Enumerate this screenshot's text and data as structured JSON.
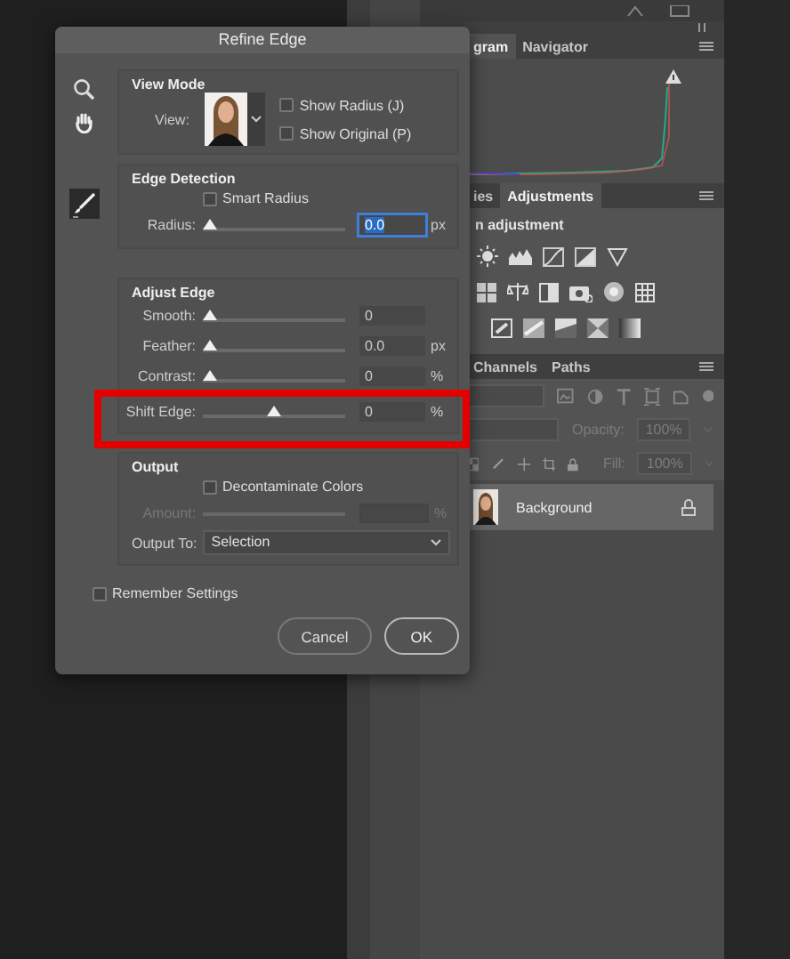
{
  "panels": {
    "top_tabs": [
      {
        "label": "gram",
        "selected": true
      },
      {
        "label": "Navigator",
        "selected": false
      }
    ],
    "adjust_tabs": [
      {
        "label": "ies",
        "selected": false
      },
      {
        "label": "Adjustments",
        "selected": true
      }
    ],
    "adjust_hint": "n adjustment",
    "layer_tabs": [
      {
        "label": "Channels",
        "selected": false
      },
      {
        "label": "Paths",
        "selected": false
      }
    ],
    "opacity": {
      "label": "Opacity:",
      "value": "100%",
      "disabled": true
    },
    "fill": {
      "label": "Fill:",
      "value": "100%",
      "disabled": true
    },
    "layers": [
      {
        "name": "Background",
        "locked": true,
        "selected": true
      }
    ]
  },
  "dialog": {
    "title": "Refine Edge",
    "view_mode": {
      "heading": "View Mode",
      "view_label": "View:",
      "options": [
        {
          "label": "Show Radius (J)",
          "checked": false
        },
        {
          "label": "Show Original (P)",
          "checked": false
        }
      ]
    },
    "edge_detection": {
      "heading": "Edge Detection",
      "smart_radius": {
        "label": "Smart Radius",
        "checked": false
      },
      "radius": {
        "label": "Radius:",
        "level": 0,
        "value": "0.0",
        "unit": "px",
        "focused": true
      }
    },
    "adjust_edge": {
      "heading": "Adjust Edge",
      "sliders": [
        {
          "label": "Smooth:",
          "level": 0,
          "value": "0",
          "highlighted": false
        },
        {
          "label": "Feather:",
          "level": 0,
          "value": "0.0",
          "unit": "px",
          "highlighted": false
        },
        {
          "label": "Contrast:",
          "level": 0,
          "value": "0",
          "unit": "%",
          "highlighted": false
        },
        {
          "label": "Shift Edge:",
          "level": 0.5,
          "value": "0",
          "unit": "%",
          "highlighted": true
        }
      ]
    },
    "output": {
      "heading": "Output",
      "decontaminate": {
        "label": "Decontaminate Colors",
        "checked": false
      },
      "amount": {
        "label": "Amount:",
        "unit": "%",
        "disabled": true
      },
      "output_to": {
        "label": "Output To:",
        "value": "Selection"
      }
    },
    "remember": {
      "label": "Remember Settings",
      "checked": false
    },
    "buttons": [
      {
        "label": "Cancel",
        "default": false
      },
      {
        "label": "OK",
        "default": true
      }
    ]
  }
}
